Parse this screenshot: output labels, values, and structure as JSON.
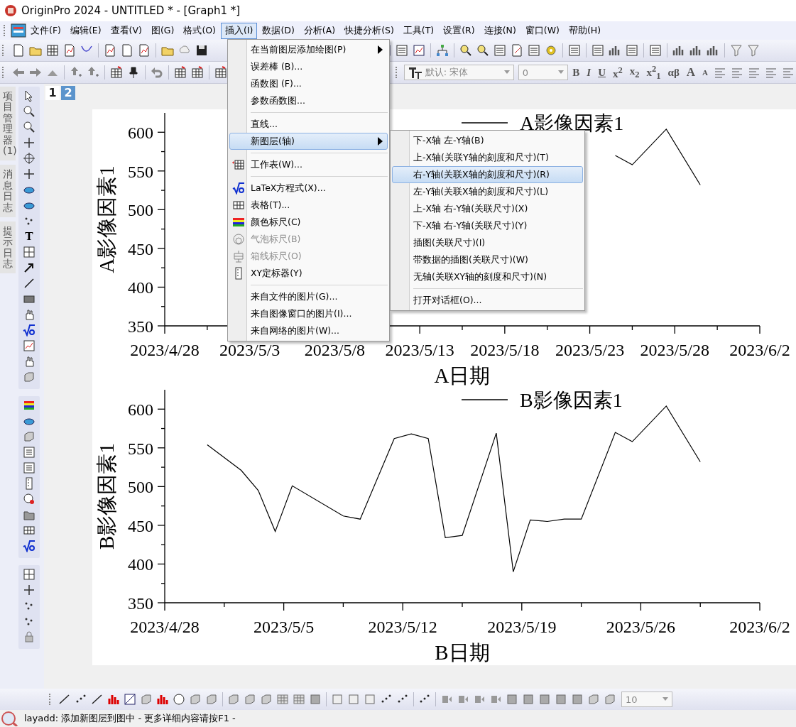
{
  "window": {
    "title": "OriginPro 2024 - UNTITLED * - [Graph1 *]"
  },
  "menubar": {
    "items": [
      {
        "label": "文件(F)",
        "selected": false
      },
      {
        "label": "编辑(E)",
        "selected": false
      },
      {
        "label": "查看(V)",
        "selected": false
      },
      {
        "label": "图(G)",
        "selected": false
      },
      {
        "label": "格式(O)",
        "selected": false
      },
      {
        "label": "插入(I)",
        "selected": true
      },
      {
        "label": "数据(D)",
        "selected": false
      },
      {
        "label": "分析(A)",
        "selected": false
      },
      {
        "label": "快捷分析(S)",
        "selected": false
      },
      {
        "label": "工具(T)",
        "selected": false
      },
      {
        "label": "设置(R)",
        "selected": false
      },
      {
        "label": "连接(N)",
        "selected": false
      },
      {
        "label": "窗口(W)",
        "selected": false
      },
      {
        "label": "帮助(H)",
        "selected": false
      }
    ]
  },
  "format_toolbar": {
    "font": "默认: 宋体",
    "size": "0",
    "buttons": [
      {
        "label": "B",
        "kind": "bold"
      },
      {
        "label": "I",
        "kind": "italic"
      },
      {
        "label": "U",
        "kind": "underline"
      },
      {
        "label": "x$^{2}$",
        "kind": "plain"
      },
      {
        "label": "x$_{2}$",
        "kind": "plain"
      },
      {
        "label": "x$^{2}$$_{1}$",
        "kind": "plain"
      },
      {
        "label": "αβ",
        "kind": "plain"
      },
      {
        "label": "A",
        "kind": "grow"
      },
      {
        "label": "A",
        "kind": "shrink"
      }
    ]
  },
  "sidebar": {
    "tabs": [
      "项目管理器 (1)",
      "消息日志",
      "提示日志"
    ],
    "text_tool": "T"
  },
  "graph": {
    "pages": [
      {
        "label": "1",
        "selected": false
      },
      {
        "label": "2",
        "selected": true
      }
    ],
    "charts": [
      {
        "chart_data": {
          "type": "line",
          "xlabel": "A日期",
          "ylabel": "A影像因素1",
          "categories": [
            "2023/4/28",
            null,
            null,
            null,
            null,
            null,
            null,
            null,
            null,
            null,
            "2023/5/3",
            null,
            null,
            null,
            null,
            null,
            null,
            null,
            null,
            null,
            "2023/5/8",
            null,
            null,
            null,
            null,
            null,
            null,
            null,
            null,
            null,
            "2023/5/13",
            null,
            null,
            null,
            null,
            null,
            null,
            null,
            null,
            null,
            "2023/5/18",
            null,
            null,
            null,
            null,
            null,
            null,
            null,
            null,
            null,
            "2023/5/23",
            null,
            null,
            null,
            null,
            null,
            null,
            null,
            null,
            null,
            "2023/5/28",
            null,
            null,
            null,
            null,
            null,
            null,
            null,
            null,
            null,
            "2023/6/2"
          ],
          "series": [
            {
              "name": "A影像因素1",
              "color": "#000000",
              "values": [
                null,
                null,
                null,
                null,
                null,
                null,
                null,
                null,
                null,
                null,
                null,
                null,
                null,
                null,
                null,
                null,
                null,
                null,
                null,
                null,
                null,
                null,
                null,
                null,
                null,
                null,
                null,
                null,
                null,
                null,
                null,
                null,
                null,
                null,
                null,
                null,
                null,
                null,
                null,
                null,
                null,
                null,
                null,
                null,
                null,
                null,
                null,
                null,
                null,
                null,
                null,
                null,
                null,
                570,
                null,
                558,
                null,
                null,
                null,
                604,
                null,
                null,
                null,
                532,
                null,
                null,
                null,
                null,
                null,
                null,
                null
              ]
            }
          ],
          "ylim": [
            350,
            625
          ],
          "yticks": [
            350,
            400,
            450,
            500,
            550,
            600
          ]
        }
      },
      {
        "chart_data": {
          "type": "line",
          "xlabel": "B日期",
          "ylabel": "B影像因素1",
          "categories": [
            "2023/4/28",
            null,
            null,
            null,
            null,
            null,
            null,
            null,
            null,
            null,
            null,
            null,
            null,
            null,
            "2023/5/5",
            null,
            null,
            null,
            null,
            null,
            null,
            null,
            null,
            null,
            null,
            null,
            null,
            null,
            "2023/5/12",
            null,
            null,
            null,
            null,
            null,
            null,
            null,
            null,
            null,
            null,
            null,
            null,
            null,
            "2023/5/19",
            null,
            null,
            null,
            null,
            null,
            null,
            null,
            null,
            null,
            null,
            null,
            null,
            null,
            "2023/5/26",
            null,
            null,
            null,
            null,
            null,
            null,
            null,
            null,
            null,
            null,
            null,
            null,
            null,
            "2023/6/2"
          ],
          "series": [
            {
              "name": "B影像因素1",
              "color": "#000000",
              "values": [
                null,
                null,
                null,
                null,
                null,
                554,
                null,
                null,
                null,
                521,
                null,
                495,
                null,
                442,
                null,
                501,
                null,
                null,
                null,
                null,
                null,
                462,
                null,
                458,
                null,
                null,
                null,
                562,
                null,
                568,
                null,
                562,
                null,
                434,
                null,
                437,
                null,
                null,
                null,
                569,
                null,
                390,
                null,
                457,
                null,
                455,
                null,
                458,
                null,
                458,
                null,
                null,
                null,
                570,
                null,
                558,
                null,
                null,
                null,
                604,
                null,
                null,
                null,
                532,
                null,
                null,
                null,
                null,
                null,
                null,
                null
              ]
            }
          ],
          "ylim": [
            350,
            625
          ],
          "yticks": [
            350,
            400,
            450,
            500,
            550,
            600
          ]
        }
      }
    ]
  },
  "insert_menu": {
    "items": [
      {
        "kind": "item",
        "label": "在当前图层添加绘图(P)",
        "submenu": true,
        "selected": false,
        "disabled": false
      },
      {
        "kind": "item",
        "label": "误差棒 (B)...",
        "submenu": false,
        "selected": false,
        "disabled": false
      },
      {
        "kind": "item",
        "label": "函数图 (F)...",
        "submenu": false,
        "selected": false,
        "disabled": false
      },
      {
        "kind": "item",
        "label": "参数函数图...",
        "submenu": false,
        "selected": false,
        "disabled": false
      },
      {
        "kind": "separator"
      },
      {
        "kind": "item",
        "label": "直线...",
        "submenu": false,
        "selected": false,
        "disabled": false
      },
      {
        "kind": "item",
        "label": "新图层(轴)",
        "submenu": true,
        "selected": true,
        "disabled": false
      },
      {
        "kind": "separator"
      },
      {
        "kind": "item",
        "label": "工作表(W)...",
        "submenu": false,
        "selected": false,
        "disabled": false
      },
      {
        "kind": "separator"
      },
      {
        "kind": "item",
        "label": "LaTeX方程式(X)...",
        "submenu": false,
        "selected": false,
        "disabled": false
      },
      {
        "kind": "item",
        "label": "表格(T)...",
        "submenu": false,
        "selected": false,
        "disabled": false
      },
      {
        "kind": "item",
        "label": "颜色标尺(C)",
        "submenu": false,
        "selected": false,
        "disabled": false
      },
      {
        "kind": "item",
        "label": "气泡标尺(B)",
        "submenu": false,
        "selected": false,
        "disabled": true
      },
      {
        "kind": "item",
        "label": "箱线标尺(O)",
        "submenu": false,
        "selected": false,
        "disabled": true
      },
      {
        "kind": "item",
        "label": "XY定标器(Y)",
        "submenu": false,
        "selected": false,
        "disabled": false
      },
      {
        "kind": "separator"
      },
      {
        "kind": "item",
        "label": "来自文件的图片(G)...",
        "submenu": false,
        "selected": false,
        "disabled": false
      },
      {
        "kind": "item",
        "label": "来自图像窗口的图片(I)...",
        "submenu": false,
        "selected": false,
        "disabled": false
      },
      {
        "kind": "item",
        "label": "来自网络的图片(W)...",
        "submenu": false,
        "selected": false,
        "disabled": false
      }
    ]
  },
  "layer_submenu": {
    "items": [
      {
        "kind": "item",
        "label": "下-X轴 左-Y轴(B)",
        "selected": false
      },
      {
        "kind": "item",
        "label": "上-X轴(关联Y轴的刻度和尺寸)(T)",
        "selected": false
      },
      {
        "kind": "item",
        "label": "右-Y轴(关联X轴的刻度和尺寸)(R)",
        "selected": true
      },
      {
        "kind": "item",
        "label": "左-Y轴(关联X轴的刻度和尺寸)(L)",
        "selected": false
      },
      {
        "kind": "item",
        "label": "上-X轴 右-Y轴(关联尺寸)(X)",
        "selected": false
      },
      {
        "kind": "item",
        "label": "下-X轴 右-Y轴(关联尺寸)(Y)",
        "selected": false
      },
      {
        "kind": "item",
        "label": "插图(关联尺寸)(I)",
        "selected": false
      },
      {
        "kind": "item",
        "label": "带数据的插图(关联尺寸)(W)",
        "selected": false
      },
      {
        "kind": "item",
        "label": "无轴(关联XY轴的刻度和尺寸)(N)",
        "selected": false
      },
      {
        "kind": "separator"
      },
      {
        "kind": "item",
        "label": "打开对话框(O)...",
        "selected": false
      }
    ]
  },
  "bottom_toolbar": {
    "size": "10"
  },
  "status_bar": {
    "text": "layadd: 添加新图层到图中 - 更多详细内容请按F1 -"
  }
}
